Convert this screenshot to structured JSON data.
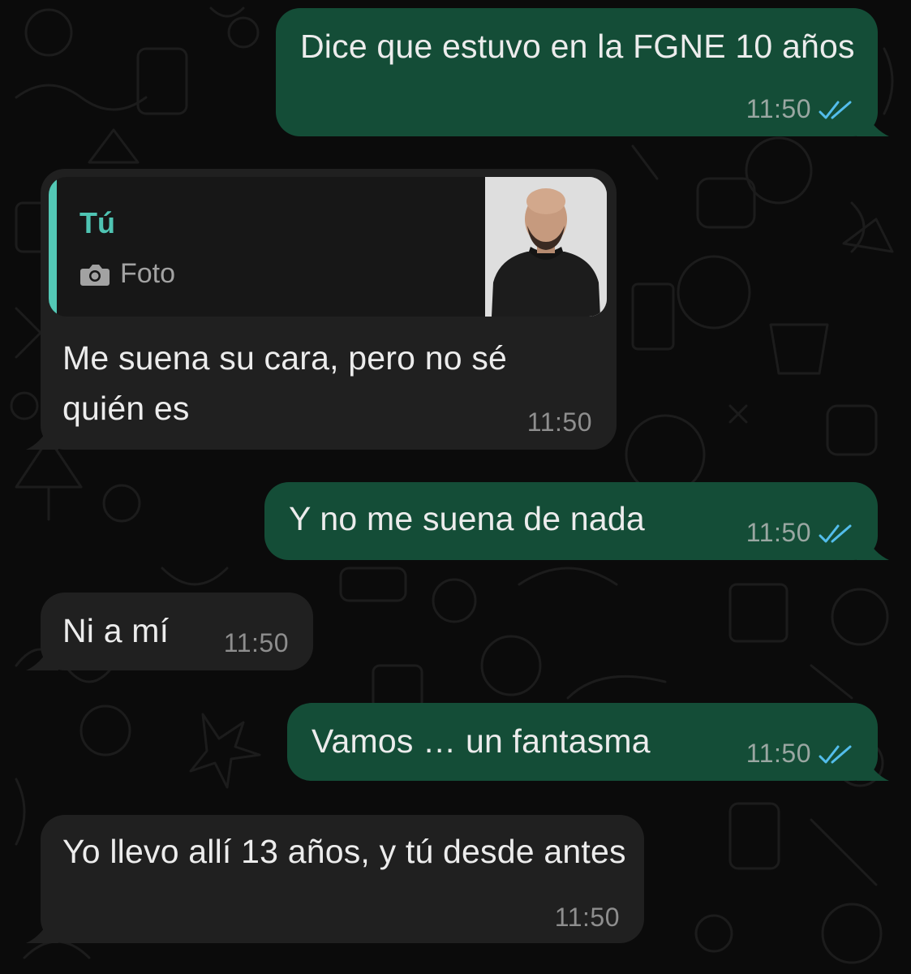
{
  "messages": [
    {
      "direction": "outgoing",
      "text": "Dice que estuvo en la FGNE 10 años",
      "time": "11:50",
      "status": "read"
    },
    {
      "direction": "incoming",
      "reply_to": {
        "author": "Tú",
        "type_icon": "camera-icon",
        "type_label": "Foto"
      },
      "text": "Me suena su cara, pero no sé quién es",
      "time": "11:50"
    },
    {
      "direction": "outgoing",
      "text": "Y no me suena de nada",
      "time": "11:50",
      "status": "read"
    },
    {
      "direction": "incoming",
      "text": "Ni a mí",
      "time": "11:50"
    },
    {
      "direction": "outgoing",
      "text": "Vamos … un fantasma",
      "time": "11:50",
      "status": "read"
    },
    {
      "direction": "incoming",
      "text": "Yo llevo allí 13 años, y tú desde antes",
      "time": "11:50"
    }
  ],
  "colors": {
    "background": "#0b0b0b",
    "outgoing_bubble": "#144d37",
    "incoming_bubble": "#202020",
    "read_ticks": "#53bdeb",
    "quote_accent": "#53c8b6"
  }
}
